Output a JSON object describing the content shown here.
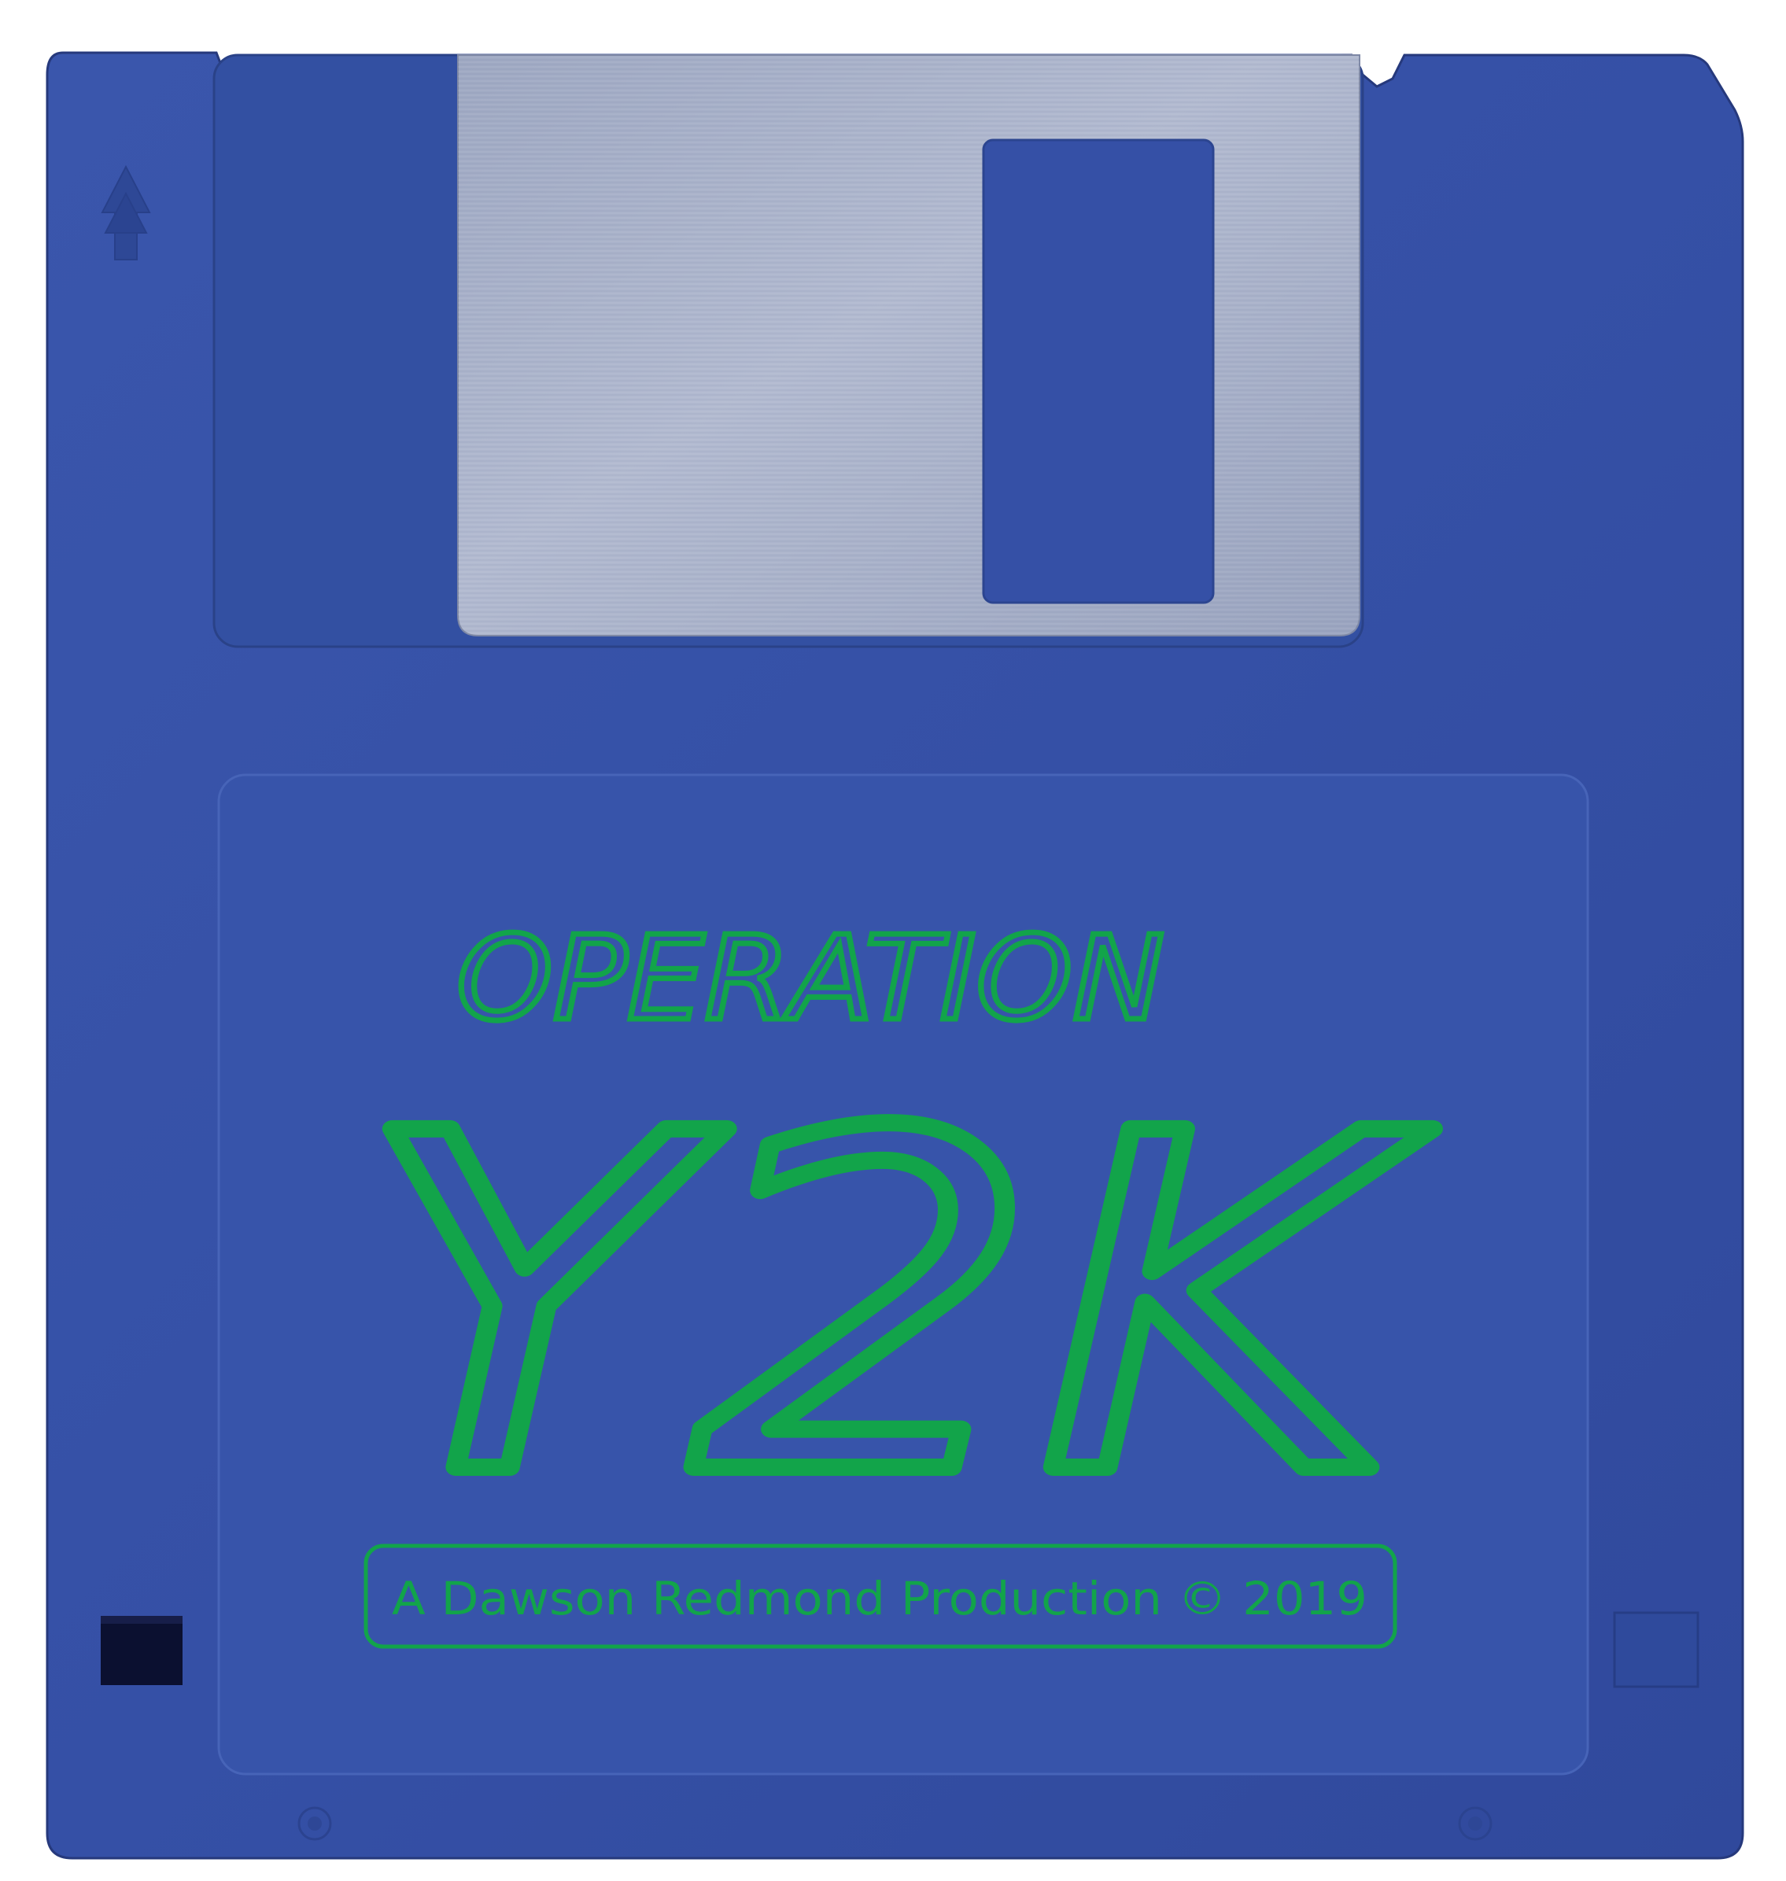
{
  "label": {
    "title_line_1": "OPERATION",
    "title_line_2": "Y2K",
    "credit": "A Dawson Redmond Production © 2019"
  },
  "colors": {
    "disk_body": "#3550a6",
    "disk_edge": "#2c4590",
    "shutter": "#a7b0c8",
    "label_ink": "#12a44a",
    "write_protect": "#0b1030"
  },
  "icons": {
    "insert_direction": "up-arrow-icon"
  }
}
